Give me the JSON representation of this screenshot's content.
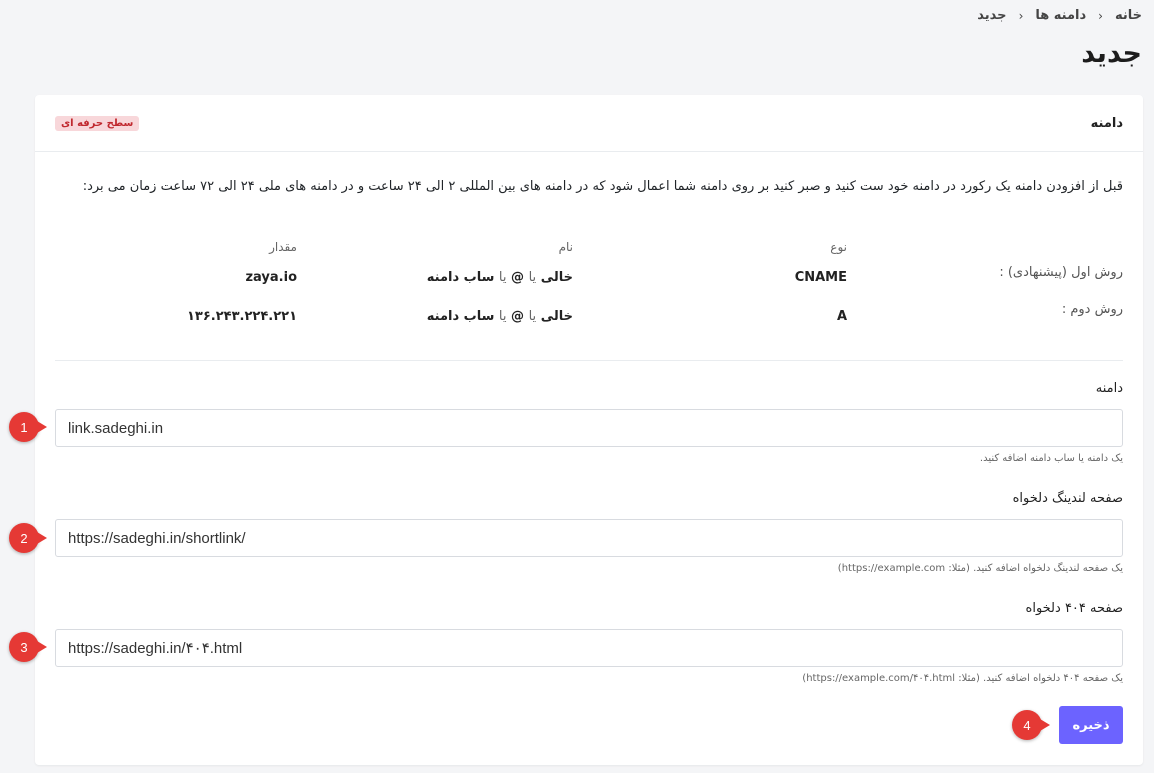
{
  "breadcrumb": {
    "home": "خانه",
    "domains": "دامنه ها",
    "current": "جدید",
    "sep": "›"
  },
  "page_title": "جدید",
  "card": {
    "title": "دامنه",
    "badge": "سطح حرفه ای",
    "intro": "قبل از افزودن دامنه یک رکورد در دامنه خود ست کنید و صبر کنید بر روی دامنه شما اعمال شود که در دامنه های بین المللی ۲ الی ۲۴ ساعت و در دامنه های ملی ۲۴ الی ۷۲ ساعت زمان می برد:",
    "records": {
      "col_type": "نوع",
      "col_name": "نام",
      "col_value": "مقدار",
      "rows": [
        {
          "method": "روش اول (پیشنهادی) :",
          "type": "CNAME",
          "name_a": "خالی",
          "name_or1": "یا",
          "name_at": "@",
          "name_or2": "یا",
          "name_b": "ساب دامنه",
          "value": "zaya.io"
        },
        {
          "method": "روش دوم :",
          "type": "A",
          "name_a": "خالی",
          "name_or1": "یا",
          "name_at": "@",
          "name_or2": "یا",
          "name_b": "ساب دامنه",
          "value": "۱۳۶.۲۴۳.۲۲۴.۲۲۱"
        }
      ]
    }
  },
  "form": {
    "domain": {
      "label": "دامنه",
      "value": "link.sadeghi.in",
      "help": "یک دامنه یا ساب دامنه اضافه کنید."
    },
    "landing": {
      "label": "صفحه لندینگ دلخواه",
      "value": "https://sadeghi.in/shortlink/",
      "help": "یک صفحه لندینگ دلخواه اضافه کنید. (مثلا: https://example.com)"
    },
    "not_found": {
      "label": "صفحه ۴۰۴ دلخواه",
      "value": "https://sadeghi.in/۴۰۴.html",
      "help": "یک صفحه ۴۰۴ دلخواه اضافه کنید. (مثلا: https://example.com/۴۰۴.html)"
    },
    "save_label": "ذخیره"
  },
  "markers": [
    "1",
    "2",
    "3",
    "4"
  ],
  "colors": {
    "primary": "#6c63ff",
    "marker": "#e53935",
    "badge_bg": "#f8d7da",
    "badge_text": "#c0282e"
  }
}
